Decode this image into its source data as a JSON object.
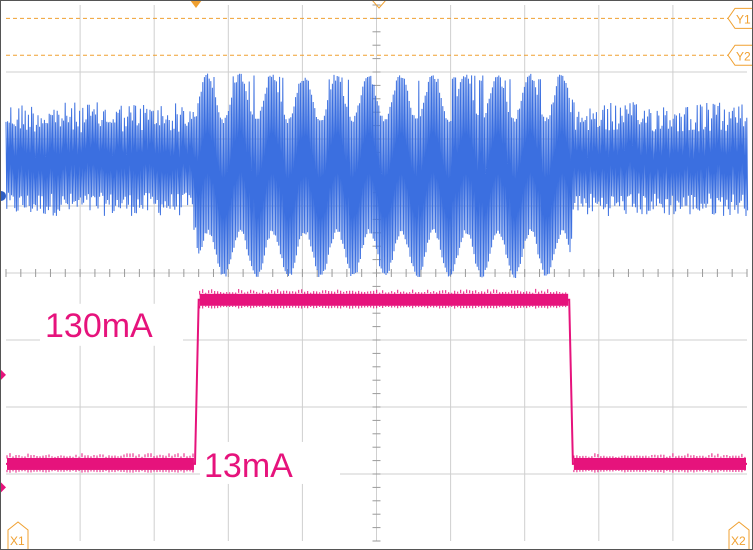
{
  "chart_data": {
    "type": "line",
    "title": "",
    "xlabel": "",
    "ylabel": "",
    "divisions": {
      "x": 10,
      "y": 8
    },
    "grid": true,
    "series": [
      {
        "channel": 1,
        "color": "#3b6fe0",
        "mode": "switching burst",
        "x_div": [
          0.0,
          2.5,
          2.6,
          7.6,
          7.65,
          10.0
        ],
        "burst_high_div": [
          6.55,
          6.55,
          6.95,
          6.95,
          6.55,
          6.55
        ],
        "burst_low_div": [
          4.85,
          4.85,
          3.95,
          3.95,
          4.85,
          4.85
        ]
      },
      {
        "channel": 2,
        "color": "#e6137c",
        "x_div": [
          0.0,
          2.55,
          2.6,
          7.6,
          7.65,
          10.0
        ],
        "y_mA": [
          13,
          13,
          130,
          130,
          13,
          13
        ]
      }
    ],
    "annotations": [
      {
        "id": "high",
        "text": "130mA",
        "value_mA": 130
      },
      {
        "id": "low",
        "text": "13mA",
        "value_mA": 13
      }
    ],
    "cursors": [
      {
        "label": "Y1",
        "color": "#f0a030"
      },
      {
        "label": "Y2",
        "color": "#f0a030"
      },
      {
        "label": "X1",
        "color": "#f0a030"
      },
      {
        "label": "X2",
        "color": "#f0a030"
      }
    ]
  }
}
